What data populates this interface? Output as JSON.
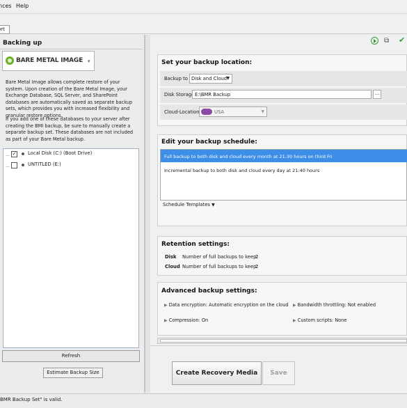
{
  "menu": {
    "item1": "nces",
    "item2": "Help"
  },
  "toolbar": {
    "button_label": "ort"
  },
  "left_panel": {
    "title": "Backing up",
    "selector": {
      "label": "BARE METAL IMAGE"
    },
    "description_1": "Bare Metal Image allows complete restore of your system. Upon creation of the Bare Metal Image, your Exchange Database, SQL Server, and SharePoint databases are automatically saved as separate backup sets, which provides you with increased flexibility and granular restore options.",
    "description_2": "If you add one of these databases to your server after creating the BMI backup, be sure to manually create a separate backup set. These databases are not included as part of your Bare Metal backup.",
    "drives": [
      {
        "label": "Local Disk (C:) (Boot Drive)",
        "checked": true
      },
      {
        "label": "UNTITLED (E:)",
        "checked": false
      }
    ],
    "refresh_label": "Refresh",
    "estimate_label": "Estimate Backup Size"
  },
  "location": {
    "title": "Set your backup location:",
    "backup_to_label": "Backup to",
    "backup_to_value": "Disk and Cloud",
    "disk_storage_label": "Disk Storage",
    "disk_storage_value": "E:\\BMR Backup",
    "browse_label": "...",
    "cloud_location_label": "Cloud-Location",
    "cloud_location_value": "USA"
  },
  "schedule": {
    "title": "Edit your backup schedule:",
    "items": [
      "Full backup to both disk and cloud every month at 21:30 hours on third Fri",
      "Incremental backup to both disk and cloud every day at 21:40 hours"
    ],
    "templates_label": "Schedule Templates"
  },
  "retention": {
    "title": "Retention settings:",
    "disk_label": "Disk",
    "disk_text": "Number of full backups to keep:",
    "disk_value": "2",
    "cloud_label": "Cloud",
    "cloud_text": "Number of full backups to keep:",
    "cloud_value": "2"
  },
  "advanced": {
    "title": "Advanced backup settings:",
    "encryption": "Data encryption: Automatic encryption on the cloud",
    "compression": "Compression: On",
    "bandwidth": "Bandwidth throttling: Not enabled",
    "scripts": "Custom scripts: None"
  },
  "actions": {
    "create_label": "Create Recovery Media",
    "save_label": "Save"
  },
  "status": {
    "text": "BMR Backup Set\" is valid."
  }
}
